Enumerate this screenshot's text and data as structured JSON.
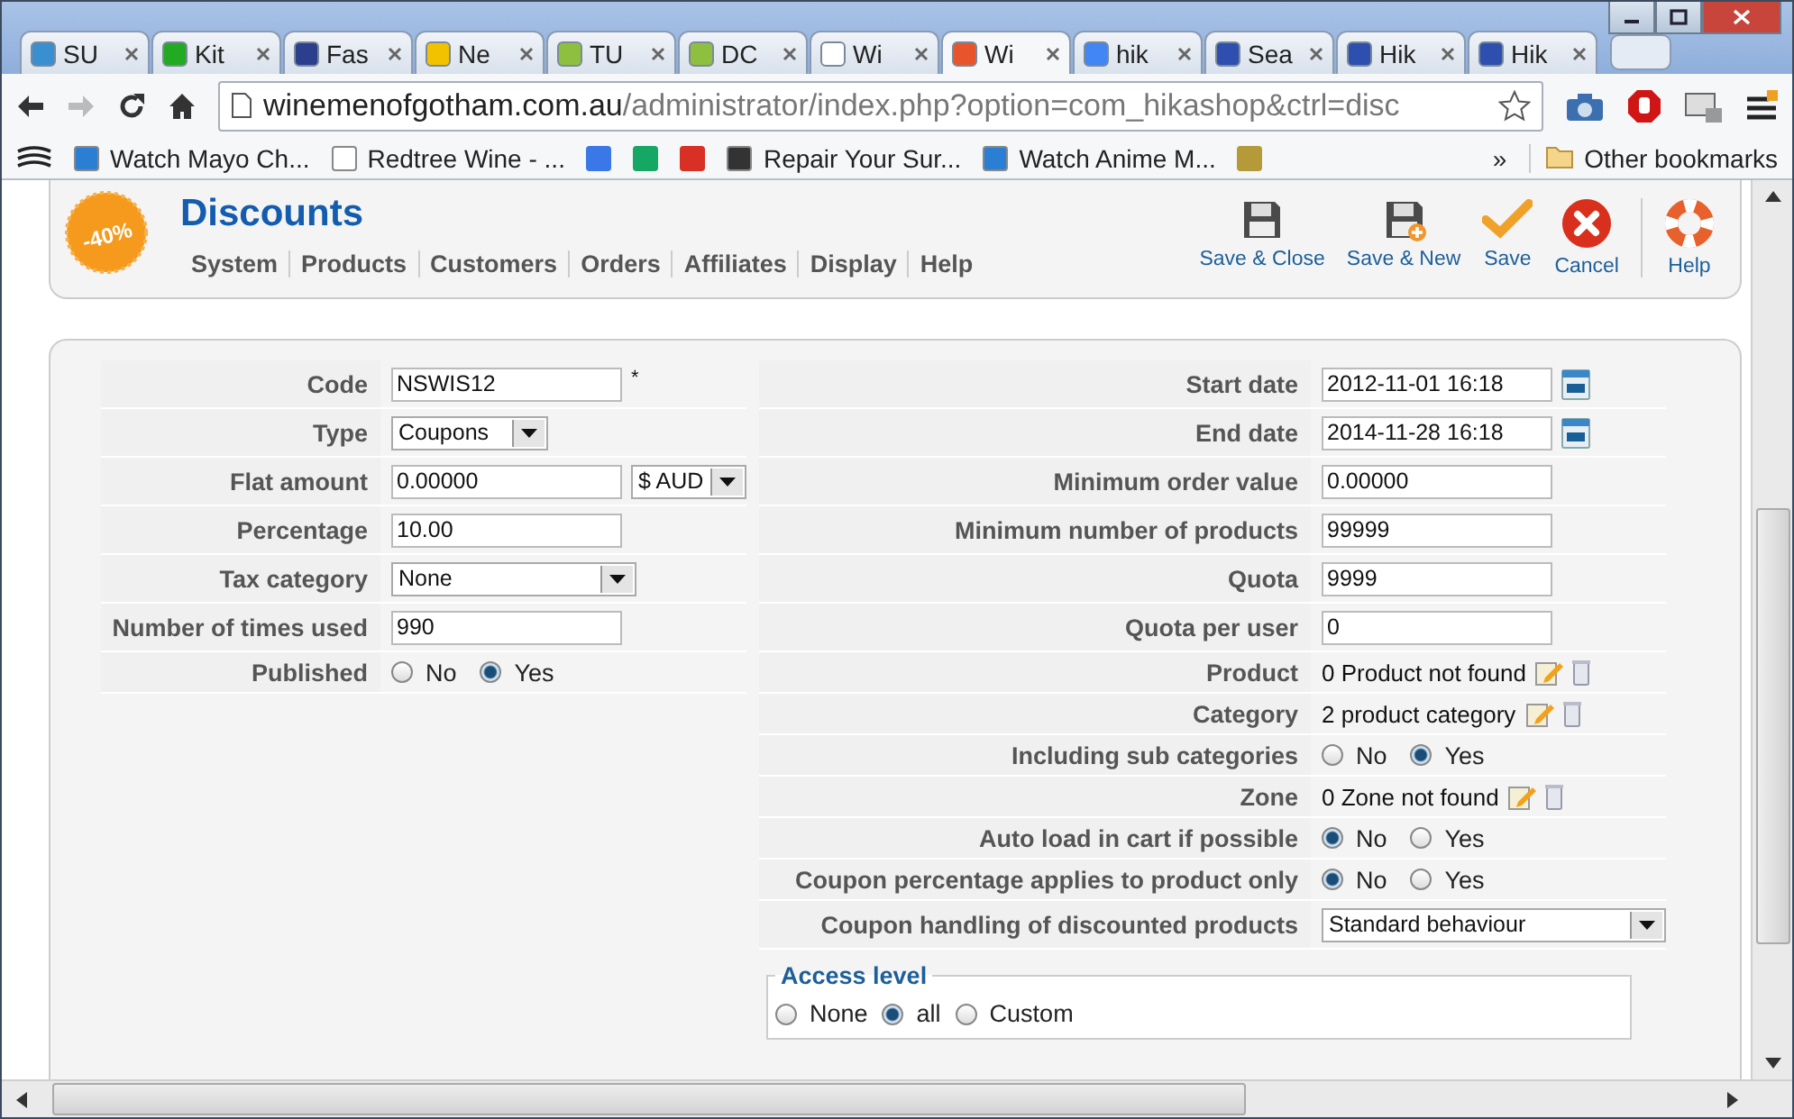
{
  "tabs": [
    {
      "label": "SU",
      "selected": false,
      "color": "#3a8fd0"
    },
    {
      "label": "Kit",
      "selected": false,
      "color": "#22aa22"
    },
    {
      "label": "Fas",
      "selected": false,
      "color": "#2b3f8c"
    },
    {
      "label": "Ne",
      "selected": false,
      "color": "#f2c200"
    },
    {
      "label": "TU",
      "selected": false,
      "color": "#8fbf3f"
    },
    {
      "label": "DC",
      "selected": false,
      "color": "#8fbf3f"
    },
    {
      "label": "Wi",
      "selected": false,
      "color": "#ffffff"
    },
    {
      "label": "Wi",
      "selected": true,
      "color": "#e8552c"
    },
    {
      "label": "hik",
      "selected": false,
      "color": "#4285f4"
    },
    {
      "label": "Sea",
      "selected": false,
      "color": "#2f4fb0"
    },
    {
      "label": "Hik",
      "selected": false,
      "color": "#2f4fb0"
    },
    {
      "label": "Hik",
      "selected": false,
      "color": "#2f4fb0"
    }
  ],
  "address": {
    "host": "winemenofgotham.com.au",
    "path": "/administrator/index.php?option=com_hikashop&ctrl=disc"
  },
  "bookmarks": [
    {
      "kind": "logo"
    },
    {
      "kind": "link",
      "label": "Watch Mayo Ch...",
      "color": "#2a7fd4"
    },
    {
      "kind": "link",
      "label": "Redtree Wine - ...",
      "color": "#ffffff"
    },
    {
      "kind": "icon",
      "color": "#3b78e7"
    },
    {
      "kind": "icon",
      "color": "#16a765"
    },
    {
      "kind": "icon",
      "color": "#d93025"
    },
    {
      "kind": "link",
      "label": "Repair Your Sur...",
      "color": "#333333"
    },
    {
      "kind": "link",
      "label": "Watch Anime M...",
      "color": "#2a7fd4"
    },
    {
      "kind": "icon",
      "color": "#b59a3a"
    }
  ],
  "bookmarks_more": "»",
  "other_bookmarks": "Other bookmarks",
  "header": {
    "badge": "-40%",
    "title": "Discounts",
    "menu": [
      "System",
      "Products",
      "Customers",
      "Orders",
      "Affiliates",
      "Display",
      "Help"
    ]
  },
  "toolbar": [
    {
      "kind": "save-close",
      "label": "Save & Close"
    },
    {
      "kind": "save-new",
      "label": "Save & New"
    },
    {
      "kind": "save",
      "label": "Save"
    },
    {
      "kind": "cancel",
      "label": "Cancel"
    },
    {
      "kind": "help",
      "label": "Help"
    }
  ],
  "left_fields": [
    {
      "kind": "text",
      "label": "Code",
      "value": "NSWIS12",
      "required": "*"
    },
    {
      "kind": "select",
      "label": "Type",
      "value": "Coupons"
    },
    {
      "kind": "text_select",
      "label": "Flat amount",
      "value": "0.00000",
      "option": "$ AUD"
    },
    {
      "kind": "text",
      "label": "Percentage",
      "value": "10.00"
    },
    {
      "kind": "wide_select",
      "label": "Tax category",
      "value": "None"
    },
    {
      "kind": "text",
      "label": "Number of times used",
      "value": "990"
    },
    {
      "kind": "radio",
      "label": "Published",
      "options": [
        {
          "label": "No",
          "selected": false
        },
        {
          "label": "Yes",
          "selected": true
        }
      ]
    }
  ],
  "right_fields": [
    {
      "kind": "date",
      "label": "Start date",
      "value": "2012-11-01 16:18"
    },
    {
      "kind": "date",
      "label": "End date",
      "value": "2014-11-28 16:18"
    },
    {
      "kind": "text",
      "label": "Minimum order value",
      "value": "0.00000"
    },
    {
      "kind": "text",
      "label": "Minimum number of products",
      "value": "99999"
    },
    {
      "kind": "text",
      "label": "Quota",
      "value": "9999"
    },
    {
      "kind": "text",
      "label": "Quota per user",
      "value": "0"
    },
    {
      "kind": "link",
      "label": "Product",
      "value": "0 Product not found"
    },
    {
      "kind": "link",
      "label": "Category",
      "value": "2 product category"
    },
    {
      "kind": "radio",
      "label": "Including sub categories",
      "options": [
        {
          "label": "No",
          "selected": false
        },
        {
          "label": "Yes",
          "selected": true
        }
      ]
    },
    {
      "kind": "link",
      "label": "Zone",
      "value": "0 Zone not found"
    },
    {
      "kind": "radio",
      "label": "Auto load in cart if possible",
      "options": [
        {
          "label": "No",
          "selected": true
        },
        {
          "label": "Yes",
          "selected": false
        }
      ]
    },
    {
      "kind": "radio",
      "label": "Coupon percentage applies to product only",
      "options": [
        {
          "label": "No",
          "selected": true
        },
        {
          "label": "Yes",
          "selected": false
        }
      ]
    },
    {
      "kind": "wide_select",
      "label": "Coupon handling of discounted products",
      "value": "Standard behaviour"
    }
  ],
  "access_level": {
    "legend": "Access level",
    "options": [
      {
        "label": "None",
        "selected": false
      },
      {
        "label": "all",
        "selected": true
      },
      {
        "label": "Custom",
        "selected": false
      }
    ]
  }
}
